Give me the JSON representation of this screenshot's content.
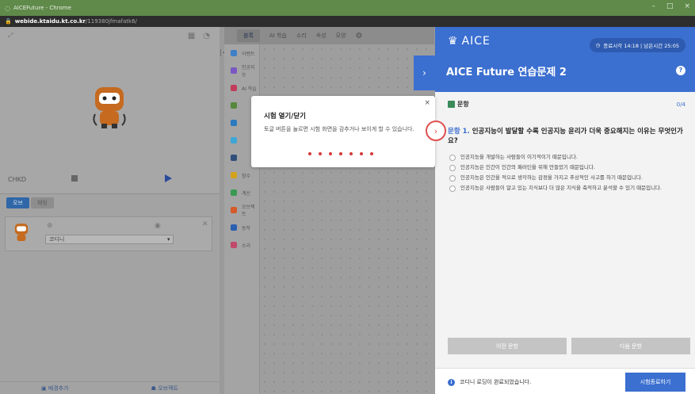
{
  "window": {
    "title": "AICEFuture - Chrome",
    "url_host": "webide.ktaidu.kt.co.kr",
    "url_path": "/119380jfmafatk6/",
    "controls": [
      "–",
      "□",
      "×"
    ]
  },
  "stage": {
    "fullscreen_icon": "expand-icon",
    "robot_icon": "robot-sprite",
    "bottom_label": "CHKD"
  },
  "object_panel": {
    "tabs": [
      "오브",
      "채팅"
    ],
    "object_name": "코디니",
    "bottom_actions": [
      "배경추가",
      "오브젝트"
    ]
  },
  "palette": {
    "tabs": [
      "블록",
      "AI 학습",
      "소리",
      "속성",
      "모양"
    ],
    "categories": [
      {
        "label": "이벤트",
        "color": "#3f7fc8"
      },
      {
        "label": "인공지능",
        "color": "#7a57c2"
      },
      {
        "label": "AI 학습",
        "color": "#c23c5a"
      },
      {
        "label": "",
        "color": "#55883a"
      },
      {
        "label": "",
        "color": "#2b7abf"
      },
      {
        "label": "",
        "color": "#3fa7d8"
      },
      {
        "label": "",
        "color": "#2f4f7a"
      },
      {
        "label": "함수",
        "color": "#d4a21a"
      },
      {
        "label": "계산",
        "color": "#3a9a52"
      },
      {
        "label": "오브젝트",
        "color": "#d45a28"
      },
      {
        "label": "동작",
        "color": "#2b5fb0"
      },
      {
        "label": "소리",
        "color": "#c2486a"
      }
    ]
  },
  "toggle": {
    "icon": "chevron-right-icon",
    "glyph": "›"
  },
  "popup": {
    "title": "시험 열기/닫기",
    "description": "토글 버튼을 눌르면 시험 화면을 감추거나 보이게 할 수 있습니다.",
    "close": "×",
    "dot_count": 7,
    "next_glyph": "›"
  },
  "question_panel": {
    "logo": "AICE",
    "timer": "종료시각 14:18 | 남은시간 25:05",
    "test_title": "AICE Future 연습문제 2",
    "help": "?",
    "section_label": "문항",
    "count": "0/4",
    "question_number": "문항 1.",
    "question_text": "인공지능이 발달할 수록 인공지능 윤리가 더욱 중요해지는 이유는 무엇인가요?",
    "options": [
      "인공지능을 개발하는 사람들이 이기적이기 때문입니다.",
      "인공지능은 인간이 인간의 패러딘을 위해 만들었기 때문입니다.",
      "인공지능은 인간을 적으로 생각하는 감정을 가지고 추상적인 사고를 하기 때문입니다.",
      "인공지능은 사람들이 알고 있는 지식보다 더 많은 지식을 축적하고 분석할 수 있기 때문입니다."
    ],
    "prev_button": "이전 문항",
    "next_button": "다음 문항",
    "loaded_message": "코디니 로딩이 완료되었습니다.",
    "end_button": "시험종료하기"
  }
}
